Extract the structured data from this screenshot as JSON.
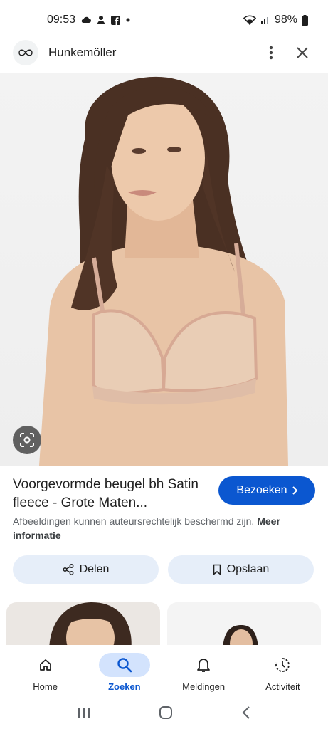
{
  "status_bar": {
    "time": "09:53",
    "battery": "98%",
    "notif_icons": [
      "cloud-icon",
      "weather-icon",
      "facebook-icon",
      "dot-icon"
    ]
  },
  "header": {
    "site_name": "Hunkemöller"
  },
  "product": {
    "title": "Voorgevormde beugel bh Satin fleece - Grote Maten...",
    "visit_label": "Bezoeken",
    "copyright_text": "Afbeeldingen kunnen auteursrechtelijk beschermd zijn.",
    "more_info_label": "Meer informatie"
  },
  "actions": {
    "share_label": "Delen",
    "save_label": "Opslaan"
  },
  "bottom_nav": {
    "items": [
      {
        "label": "Home",
        "icon": "home-icon"
      },
      {
        "label": "Zoeken",
        "icon": "search-icon"
      },
      {
        "label": "Meldingen",
        "icon": "bell-icon"
      },
      {
        "label": "Activiteit",
        "icon": "activity-icon"
      }
    ]
  },
  "colors": {
    "accent": "#0b57d0",
    "pill_bg": "#e6eef9",
    "active_nav_bg": "#d3e3fd"
  }
}
